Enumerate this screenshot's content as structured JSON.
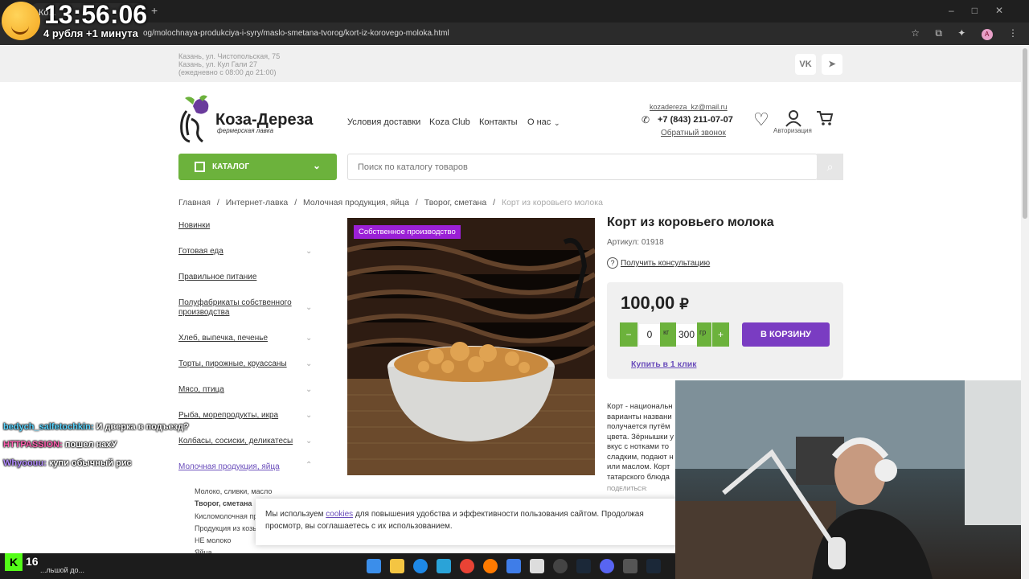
{
  "overlay": {
    "clock": "13:56:06",
    "subtitle": "4 рубля +1 минута",
    "viewers": "16",
    "chat": [
      {
        "user": "bedych_salfetochkin:",
        "text": "И дверка в подъезд?"
      },
      {
        "user": "HTTPASSION:",
        "text": "пошел нахУ"
      },
      {
        "user": "Whyoouu:",
        "text": "купи обычный рис"
      }
    ]
  },
  "browser": {
    "tab_title": "Ко...",
    "url": "og/molochnaya-produkciya-i-syry/maslo-smetana-tvorog/kort-iz-korovego-moloka.html",
    "profile": "A"
  },
  "topbar": {
    "address_line1": "Казань, ул. Чистопольская, 75",
    "address_line2": "Казань, ул. Кул Гали 27",
    "hours": "(ежедневно с 08:00 до 21:00)",
    "social_vk": "VK",
    "social_tg": "➤"
  },
  "header": {
    "logo_title": "Коза-Дереза",
    "logo_sub": "фермерская лавка",
    "nav": [
      "Условия доставки",
      "Koza Club",
      "Контакты",
      "О нас"
    ],
    "email": "kozadereza_kz@mail.ru",
    "phone": "+7 (843) 211-07-07",
    "callback": "Обратный звонок",
    "auth": "Авторизация"
  },
  "catalog": {
    "button": "КАТАЛОГ",
    "search_placeholder": "Поиск по каталогу товаров"
  },
  "breadcrumbs": [
    "Главная",
    "/",
    "Интернет-лавка",
    "/",
    "Молочная продукция, яйца",
    "/",
    "Творог, сметана",
    "/",
    "Корт из коровьего молока"
  ],
  "sidebar": {
    "items": [
      "Новинки",
      "Готовая еда",
      "Правильное питание",
      "Полуфабрикаты собственного производства",
      "Хлеб, выпечка, печенье",
      "Торты, пирожные, круассаны",
      "Мясо, птица",
      "Рыба, морепродукты, икра",
      "Колбасы, сосиски, деликатесы",
      "Молочная продукция, яйца"
    ],
    "sub_items": [
      "Молоко, сливки, масло",
      "Творог, сметана",
      "Кисломолочная пр...",
      "Продукция из козь...",
      "НЕ молоко",
      "Яйца"
    ]
  },
  "product": {
    "badge": "Собственное производство",
    "title": "Корт из коровьего молока",
    "article": "Артикул: 01918",
    "consult": "Получить консультацию",
    "price": "100,00",
    "currency": "₽",
    "minus": "−",
    "plus": "+",
    "qty_kg": "0",
    "unit_kg": "кг",
    "qty_g": "300",
    "unit_g": "гр",
    "cart": "В КОРЗИНУ",
    "one_click": "Купить в 1 клик",
    "description": "Корт - национальн варианты названи получается путём цвета. Зёрнышки у вкус с нотками то сладким, подают н или маслом. Корт татарского блюда",
    "share": "ПОДЕЛИТЬСЯ:"
  },
  "cookie": {
    "text_before": "Мы используем ",
    "link": "cookies",
    "text_after": " для повышения удобства и эффективности пользования сайтом. Продолжая просмотр, вы соглашаетесь с их использованием."
  },
  "taskbar": {
    "label": "...льшой до..."
  },
  "colors": {
    "green": "#6cb23c",
    "purple": "#7a3cc2",
    "badge": "#9b20d6"
  }
}
